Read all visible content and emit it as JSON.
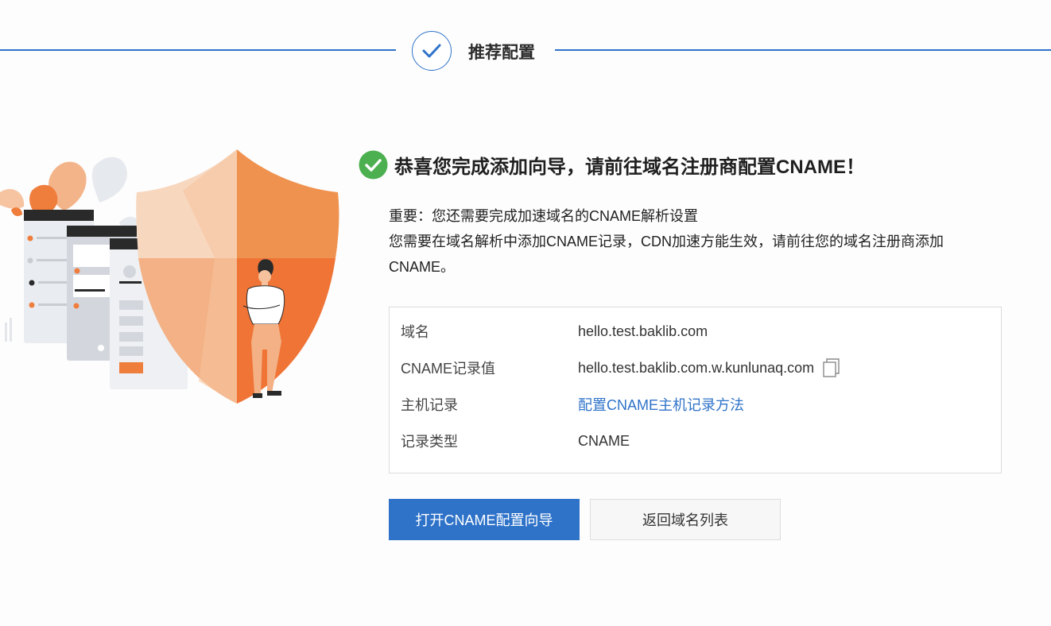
{
  "step": {
    "title": "推荐配置"
  },
  "success": {
    "title": "恭喜您完成添加向导，请前往域名注册商配置CNAME！"
  },
  "description": {
    "line1": "重要：您还需要完成加速域名的CNAME解析设置",
    "line2": "您需要在域名解析中添加CNAME记录，CDN加速方能生效，请前往您的域名注册商添加CNAME。"
  },
  "info": {
    "rows": [
      {
        "label": "域名",
        "value": "hello.test.baklib.com"
      },
      {
        "label": "CNAME记录值",
        "value": "hello.test.baklib.com.w.kunlunaq.com"
      },
      {
        "label": "主机记录",
        "value": "配置CNAME主机记录方法"
      },
      {
        "label": "记录类型",
        "value": "CNAME"
      }
    ]
  },
  "buttons": {
    "primary": "打开CNAME配置向导",
    "secondary": "返回域名列表"
  },
  "colors": {
    "accent": "#2f73c9",
    "success": "#4caf50",
    "shield_orange": "#ef7d3c"
  },
  "icons": {
    "step": "check-icon",
    "success": "check-circle-icon",
    "copy": "copy-icon"
  }
}
